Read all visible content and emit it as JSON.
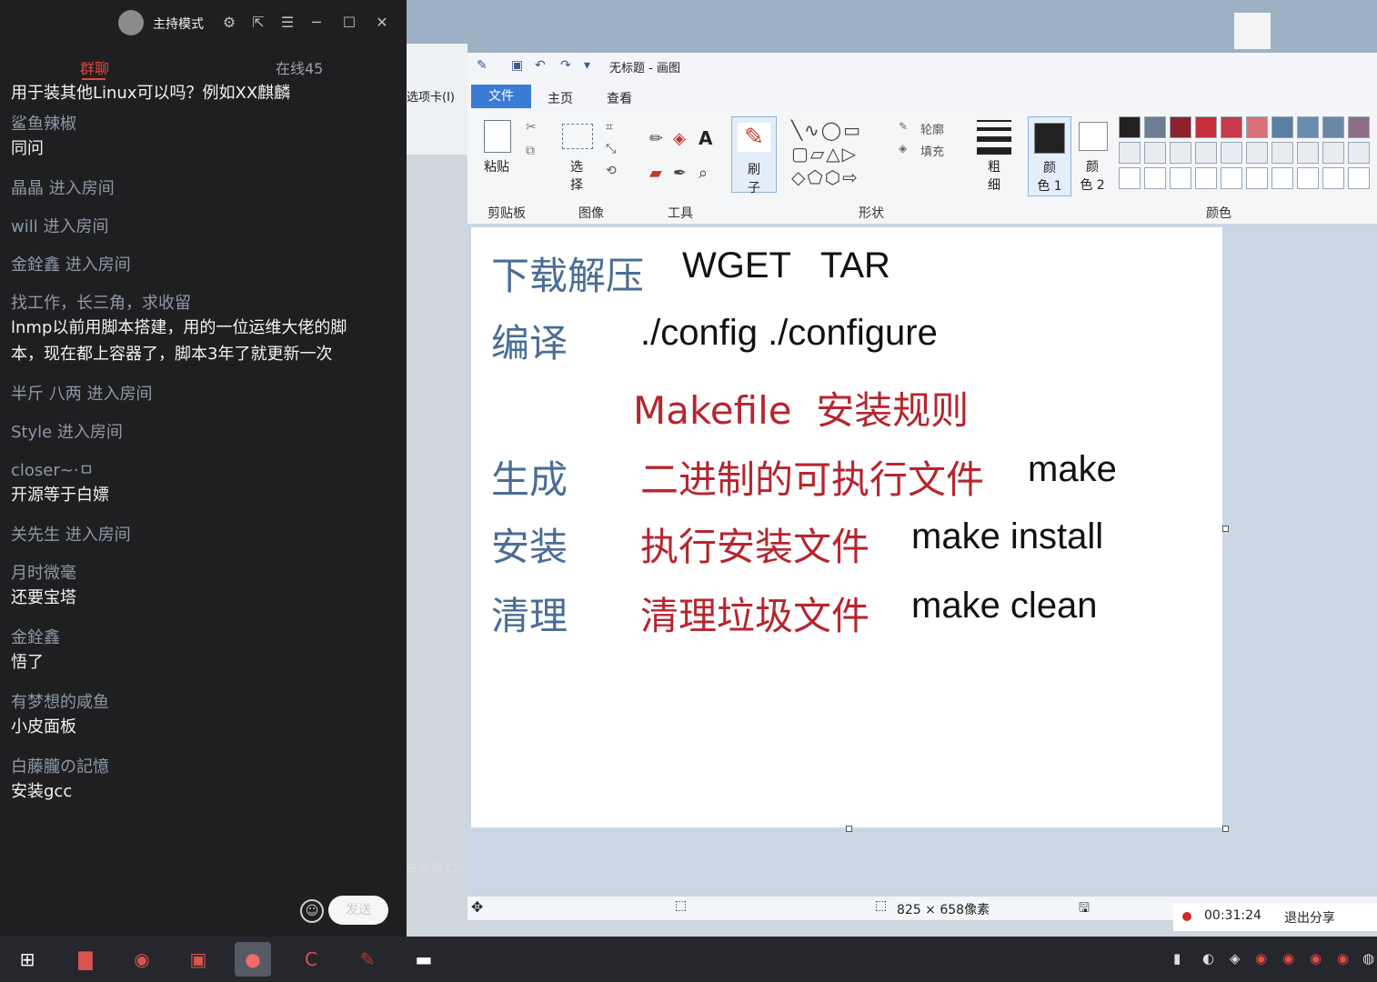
{
  "chat": {
    "mode_label": "主持模式",
    "tabs": {
      "group": "群聊",
      "online": "在线45"
    },
    "messages": [
      {
        "name": "",
        "text": "用于装其他Linux可以吗？例如XX麒麟"
      },
      {
        "name": "鲨鱼辣椒",
        "text": "同问"
      },
      {
        "name": "晶晶 进入房间",
        "text": ""
      },
      {
        "name": "will 进入房间",
        "text": ""
      },
      {
        "name": "金銓鑫     进入房间",
        "text": ""
      },
      {
        "name": "找工作，长三角，求收留",
        "text": "lnmp以前用脚本搭建，用的一位运维大佬的脚本，现在都上容器了，脚本3年了就更新一次"
      },
      {
        "name": "半斤  八两 进入房间",
        "text": ""
      },
      {
        "name": "Style 进入房间",
        "text": ""
      },
      {
        "name": "closer~·ㅁ",
        "text": "开源等于白嫖"
      },
      {
        "name": "关先生 进入房间",
        "text": ""
      },
      {
        "name": "月时微毫",
        "text": "还要宝塔"
      },
      {
        "name": "金銓鑫",
        "text": "悟了"
      },
      {
        "name": "有梦想的咸鱼",
        "text": "小皮面板"
      },
      {
        "name": "白藤朧の記憶",
        "text": "安装gcc"
      }
    ],
    "send_label": "发送"
  },
  "paint": {
    "title": "无标题 - 画图",
    "tabs": {
      "file": "文件",
      "home": "主页",
      "view": "查看"
    },
    "left_fragment": "选项卡(I)",
    "left_hint": "击或按 Ctr",
    "groups": {
      "clipboard": "剪贴板",
      "image": "图像",
      "tools": "工具",
      "shapes": "形状",
      "colors": "颜色"
    },
    "labels": {
      "paste": "粘贴",
      "select": "选\n择",
      "brush": "刷\n子",
      "outline": "轮廓",
      "fill": "填充",
      "size": "粗\n细",
      "color1": "颜\n色 1",
      "color2": "颜\n色 2"
    },
    "palette": [
      "#222222",
      "#6f7d93",
      "#8a2230",
      "#c62f3d",
      "#c83a48",
      "#d9707c",
      "#5b7ea3",
      "#6a8cb0",
      "#6b87a6",
      "#8b6f86"
    ],
    "status": {
      "size": "825 × 658像素"
    },
    "canvas_rows": [
      {
        "cn": "下载解压",
        "en": "WGET   TAR"
      },
      {
        "cn": "编译",
        "en": "./config ./configure"
      },
      {
        "red": "Makefile  安装规则"
      },
      {
        "cn": "生成",
        "red": "二进制的可执行文件",
        "en": "make"
      },
      {
        "cn": "安装",
        "red": "执行安装文件",
        "en": "make install"
      },
      {
        "cn": "清理",
        "red": "清理垃圾文件",
        "en": "make clean"
      }
    ]
  },
  "recording": {
    "time": "00:31:24",
    "exit_label": "退出分享"
  }
}
